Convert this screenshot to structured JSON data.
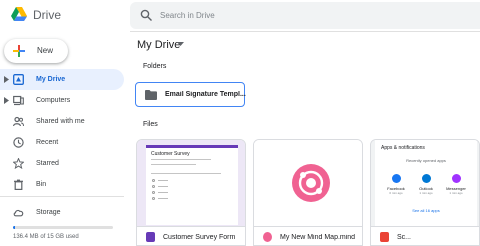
{
  "header": {
    "brand": "Drive",
    "search_placeholder": "Search in Drive"
  },
  "sidebar": {
    "new_label": "New",
    "items": [
      {
        "label": "My Drive",
        "icon": "my-drive-icon",
        "active": true
      },
      {
        "label": "Computers",
        "icon": "computers-icon"
      },
      {
        "label": "Shared with me",
        "icon": "shared-icon"
      },
      {
        "label": "Recent",
        "icon": "clock-icon"
      },
      {
        "label": "Starred",
        "icon": "star-icon"
      },
      {
        "label": "Bin",
        "icon": "trash-icon"
      }
    ],
    "storage": {
      "label": "Storage",
      "usage_text": "136.4 MB of 15 GB used",
      "used_fraction": 0.009
    }
  },
  "main": {
    "title": "My Drive",
    "folders_label": "Folders",
    "files_label": "Files",
    "folders": [
      {
        "name": "Email Signature Templ..."
      }
    ],
    "files": [
      {
        "name": "Customer Survey Form",
        "type_color": "#673ab7",
        "thumb_title": "Customer Survey"
      },
      {
        "name": "My New Mind Map.mind",
        "type_color": "#f06292"
      },
      {
        "name": "Sc...",
        "type_color": "#ea4335",
        "thumb_title": "Apps & notifications",
        "thumb_subtitle": "Recently opened apps",
        "thumb_apps": [
          {
            "label": "Facebook",
            "sub": "0 min ago",
            "color": "#1877f2"
          },
          {
            "label": "Outlook",
            "sub": "1 min ago",
            "color": "#0078d4"
          },
          {
            "label": "Messenger",
            "sub": "1 min ago",
            "color": "#a033ff"
          }
        ],
        "thumb_link": "See all 16 apps"
      }
    ]
  },
  "colors": {
    "accent": "#1a73e8",
    "active_bg": "#e8f0fe",
    "active_text": "#1967d2"
  }
}
